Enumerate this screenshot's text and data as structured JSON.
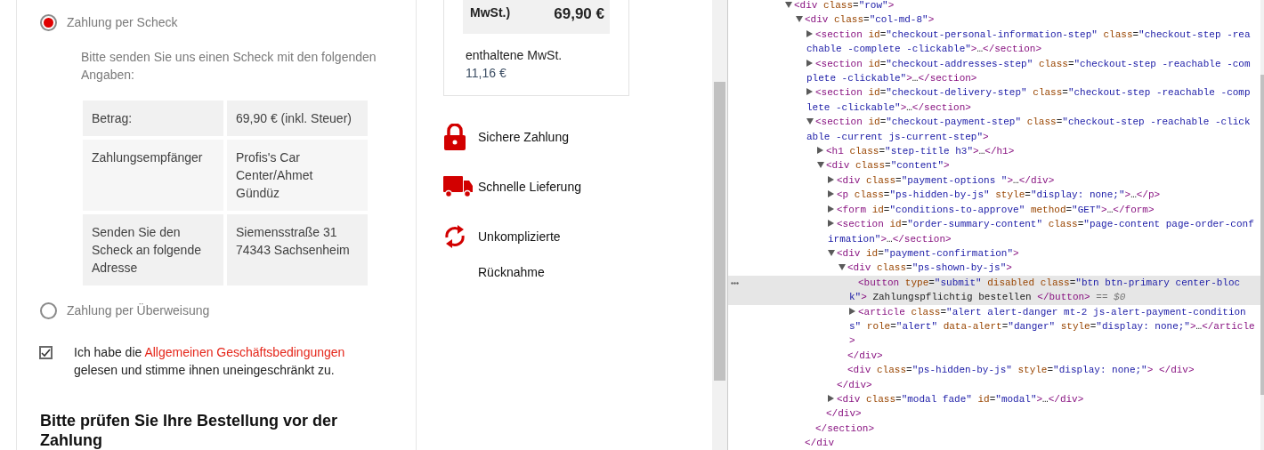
{
  "payment_options": [
    {
      "label": "Zahlung per Scheck",
      "selected": true,
      "instructions": "Bitte senden Sie uns einen Scheck mit den folgenden Angaben:",
      "details": [
        {
          "label": "Betrag:",
          "value": "69,90 € (inkl. Steuer)"
        },
        {
          "label": "Zahlungsempfänger",
          "value": "Profis's Car Center/Ahmet Gündüz"
        },
        {
          "label": "Senden Sie den Scheck an folgende Adresse",
          "value": "Siemensstraße 31\n74343 Sachsenheim"
        }
      ]
    },
    {
      "label": "Zahlung per Überweisung",
      "selected": false
    }
  ],
  "terms": {
    "checked": true,
    "text_before": "Ich habe die ",
    "link": "Allgemeinen Geschäftsbedingungen",
    "text_after": " gelesen und stimme ihnen uneingeschränkt zu."
  },
  "review_heading": "Bitte prüfen Sie Ihre Bestellung vor der Zahlung",
  "summary": {
    "total_label": "MwSt.)",
    "total_value": "69,90 €",
    "tax_label": "enthaltene MwSt.",
    "tax_value": "11,16 €"
  },
  "features": [
    {
      "kind": "lock",
      "label": "Sichere Zahlung"
    },
    {
      "kind": "truck",
      "label": "Schnelle Lieferung"
    },
    {
      "kind": "sync",
      "label": "Unkomplizierte Rücknahme"
    }
  ],
  "dom_tree": [
    {
      "markup": "<div class=\"row\">",
      "expanded": true,
      "selected": false,
      "children": [
        {
          "markup": "<div class=\"col-md-8\">",
          "expanded": true,
          "selected": false,
          "closing": "</div",
          "children": [
            {
              "markup": "<section id=\"checkout-personal-information-step\" class=\"checkout-step -reachable -complete -clickable\">…</section>",
              "expanded": false,
              "selected": false
            },
            {
              "markup": "<section id=\"checkout-addresses-step\" class=\"checkout-step -reachable -complete -clickable\">…</section>",
              "expanded": false,
              "selected": false
            },
            {
              "markup": "<section id=\"checkout-delivery-step\" class=\"checkout-step -reachable -complete -clickable\">…</section>",
              "expanded": false,
              "selected": false
            },
            {
              "markup": "<section id=\"checkout-payment-step\" class=\"checkout-step -reachable -clickable -current js-current-step\">",
              "expanded": true,
              "selected": false,
              "closing": "</section>",
              "children": [
                {
                  "markup": "<h1 class=\"step-title h3\">…</h1>",
                  "expanded": false,
                  "selected": false
                },
                {
                  "markup": "<div class=\"content\">",
                  "expanded": true,
                  "selected": false,
                  "closing": "</div>",
                  "children": [
                    {
                      "markup": "<div class=\"payment-options \">…</div>",
                      "expanded": false,
                      "selected": false
                    },
                    {
                      "markup": "<p class=\"ps-hidden-by-js\" style=\"display: none;\">…</p>",
                      "expanded": false,
                      "selected": false
                    },
                    {
                      "markup": "<form id=\"conditions-to-approve\" method=\"GET\">…</form>",
                      "expanded": false,
                      "selected": false
                    },
                    {
                      "markup": "<section id=\"order-summary-content\" class=\"page-content page-order-confirmation\">…</section>",
                      "expanded": false,
                      "selected": false
                    },
                    {
                      "markup": "<div id=\"payment-confirmation\">",
                      "expanded": true,
                      "selected": false,
                      "closing": "</div>",
                      "children": [
                        {
                          "markup": "<div class=\"ps-shown-by-js\">",
                          "expanded": true,
                          "selected": false,
                          "closing": "</div>",
                          "children": [
                            {
                              "markup": "<button type=\"submit\" disabled class=\"btn btn-primary center-block\"> Zahlungspflichtig bestellen </button> == $0",
                              "selected": true
                            },
                            {
                              "markup": "<article class=\"alert alert-danger mt-2 js-alert-payment-conditions\" role=\"alert\" data-alert=\"danger\" style=\"display: none;\">…</article>",
                              "expanded": false,
                              "selected": false
                            }
                          ]
                        },
                        {
                          "markup": "<div class=\"ps-hidden-by-js\" style=\"display: none;\"> </div>",
                          "selected": false
                        }
                      ]
                    },
                    {
                      "markup": "<div class=\"modal fade\" id=\"modal\">…</div>",
                      "expanded": false,
                      "selected": false
                    }
                  ]
                }
              ]
            }
          ]
        }
      ]
    }
  ]
}
